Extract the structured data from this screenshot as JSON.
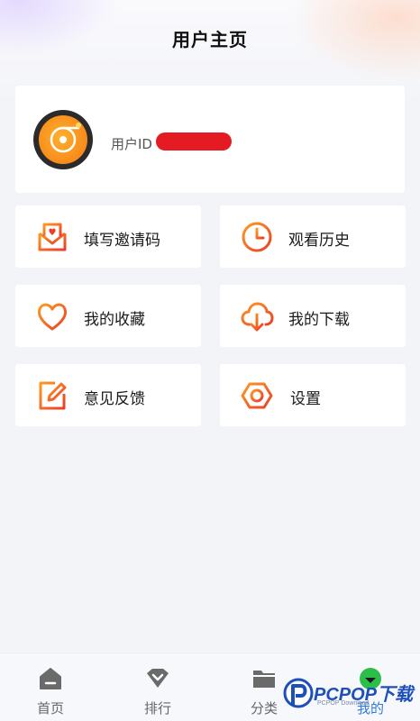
{
  "header": {
    "title": "用户主页"
  },
  "profile": {
    "user_id_label": "用户ID"
  },
  "menu": [
    {
      "label": "填写邀请码",
      "icon": "envelope-heart-icon"
    },
    {
      "label": "观看历史",
      "icon": "clock-icon"
    },
    {
      "label": "我的收藏",
      "icon": "heart-icon"
    },
    {
      "label": "我的下载",
      "icon": "cloud-download-icon"
    },
    {
      "label": "意见反馈",
      "icon": "edit-feedback-icon"
    },
    {
      "label": "设置",
      "icon": "hexagon-settings-icon"
    }
  ],
  "tabbar": {
    "tabs": [
      {
        "label": "首页",
        "icon": "home-icon"
      },
      {
        "label": "排行",
        "icon": "ranking-icon"
      },
      {
        "label": "分类",
        "icon": "folder-icon"
      },
      {
        "label": "我的",
        "icon": "profile-icon",
        "active": true
      }
    ]
  },
  "watermark": {
    "brand": "PCPOP下载",
    "sub": "PCPOP Download"
  },
  "colors": {
    "accent_orange": "#f47b12",
    "accent_red": "#e8402a",
    "tab_active": "#2f7be0",
    "redaction": "#e41b23"
  }
}
